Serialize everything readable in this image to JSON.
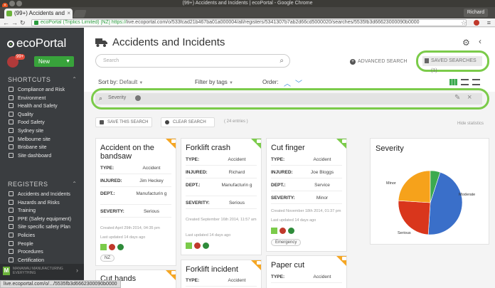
{
  "browser": {
    "window_title": "(99+) Accidents and Incidents | ecoPortal - Google Chrome",
    "tab_label": "(99+) Accidents and",
    "user": "Richard",
    "url_org": "ecoPortal (Triplics Limited) [NZ]",
    "url_scheme": "https://",
    "url_rest": "live.ecoportal.com/o/533fcad21b467ba01a000004/all/registers/5341307b7ab2d66cd5000020/searches/5535fb3d66623000090b0000",
    "status_url": "live.ecoportal.com/o/.../5535fb3d6662300090b0000"
  },
  "sidebar": {
    "logo": "ecoPortal",
    "avatar_badge": "99+",
    "new_button": "New",
    "shortcuts_heading": "SHORTCUTS",
    "shortcuts": [
      "Compliance and Risk",
      "Environment",
      "Health and Safety",
      "Quality",
      "Food Safety",
      "Sydney site",
      "Melbourne site",
      "Brisbane site",
      "Site dashboard"
    ],
    "registers_heading": "REGISTERS",
    "registers": [
      "Accidents and Incidents",
      "Hazards and Risks",
      "Training",
      "PPE (Safety equipment)",
      "Site specific safety Plan",
      "Policies",
      "People",
      "Procedures",
      "Certification"
    ],
    "footer_text": "MANAWAU MANUFACTURING EVERYTHING"
  },
  "header": {
    "title": "Accidents and Incidents",
    "search_placeholder": "Search",
    "advanced_search": "ADVANCED SEARCH",
    "saved_searches": "SAVED SEARCHES (1)",
    "sort_by_label": "Sort by:",
    "sort_by_value": "Default",
    "filter_by_tags": "Filter by tags",
    "order_label": "Order:"
  },
  "filter": {
    "text": "Severity"
  },
  "actions": {
    "save_search": "SAVE THIS SEARCH",
    "clear_search": "CLEAR SEARCH",
    "entries": "( 24 entries )",
    "hide_statistics": "Hide statistics"
  },
  "cards": [
    {
      "title": "Accident on the bandsaw",
      "type_k": "TYPE:",
      "type": "Accident",
      "injured_k": "INJURED:",
      "injured": "Jim Heckey",
      "dept_k": "DEPT.:",
      "dept": "Manufacturin g",
      "severity_k": "SEVERITY:",
      "severity": "Serious",
      "created": "Created April 29th 2014, 04:35 pm",
      "updated": "Last updated 14 days ago",
      "tag": "NZ"
    },
    {
      "title": "Forklift crash",
      "type_k": "TYPE:",
      "type": "Accident",
      "injured_k": "INJURED:",
      "injured": "Richard",
      "dept_k": "DEPT.:",
      "dept": "Manufacturin g",
      "severity_k": "SEVERITY:",
      "severity": "Serious",
      "created": "Created September 16th 2014, 11:57 am",
      "updated": "Last updated 14 days ago"
    },
    {
      "title": "Cut finger",
      "type_k": "TYPE:",
      "type": "Accident",
      "injured_k": "INJURED:",
      "injured": "Joe Bloggs",
      "dept_k": "DEPT.:",
      "dept": "Service",
      "severity_k": "SEVERITY:",
      "severity": "Minor",
      "created": "Created November 18th 2014, 01:37 pm",
      "updated": "Last updated 14 days ago",
      "tag": "Emergency"
    },
    {
      "title": "Cut hands"
    },
    {
      "title": "Forklift incident",
      "type_k": "TYPE:",
      "type": "Accident"
    },
    {
      "title": "Paper cut",
      "type_k": "TYPE:",
      "type": "Accident"
    }
  ],
  "stats": {
    "title": "Severity",
    "colors": {
      "moderate": "#3a6fc9",
      "serious": "#d9361c",
      "minor": "#f6a21b",
      "other": "#3caa4f"
    }
  },
  "chart_data": {
    "type": "pie",
    "title": "Severity",
    "categories": [
      "Moderate",
      "Serious",
      "Minor",
      ""
    ],
    "values": [
      46,
      25,
      24,
      5
    ]
  }
}
